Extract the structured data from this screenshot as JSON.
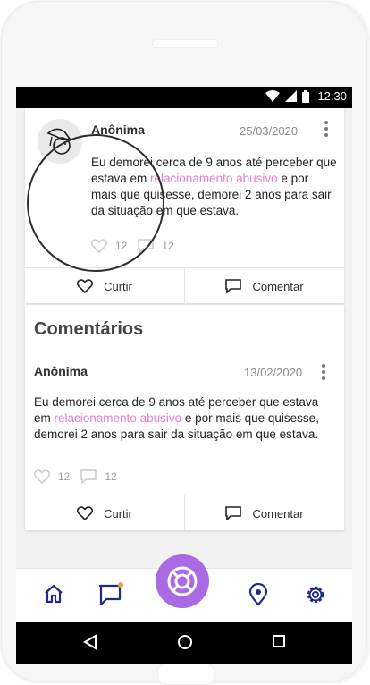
{
  "status_bar": {
    "time": "12:30"
  },
  "post": {
    "author": "Anônima",
    "date": "25/03/2020",
    "text_before": "Eu demorei cerca de 9 anos até perceber que estava em ",
    "highlight": "relacionamento abusivo",
    "text_after": " e por mais que quisesse, demorei 2 anos para sair da situação em que estava.",
    "likes": "12",
    "comments": "12",
    "like_label": "Curtir",
    "comment_label": "Comentar"
  },
  "comments_section": {
    "title": "Comentários",
    "items": [
      {
        "author": "Anônima",
        "date": "13/02/2020",
        "text_before": "Eu demorei cerca de 9 anos até perceber que estava em ",
        "highlight": "relacionamento abusivo",
        "text_after": " e por mais que quisesse, demorei 2 anos para sair da situação em que estava.",
        "likes": "12",
        "comments": "12",
        "like_label": "Curtir",
        "comment_label": "Comentar"
      }
    ]
  },
  "bottom_nav": {
    "items": [
      "home-icon",
      "chat-icon",
      "lifebuoy-icon",
      "location-pin-icon",
      "settings-icon"
    ],
    "has_notification_on": "chat-icon"
  },
  "colors": {
    "accent": "#a96ae4",
    "highlight": "#e481c7",
    "nav_icon": "#1f2a8c",
    "notification": "#f29f3f"
  }
}
